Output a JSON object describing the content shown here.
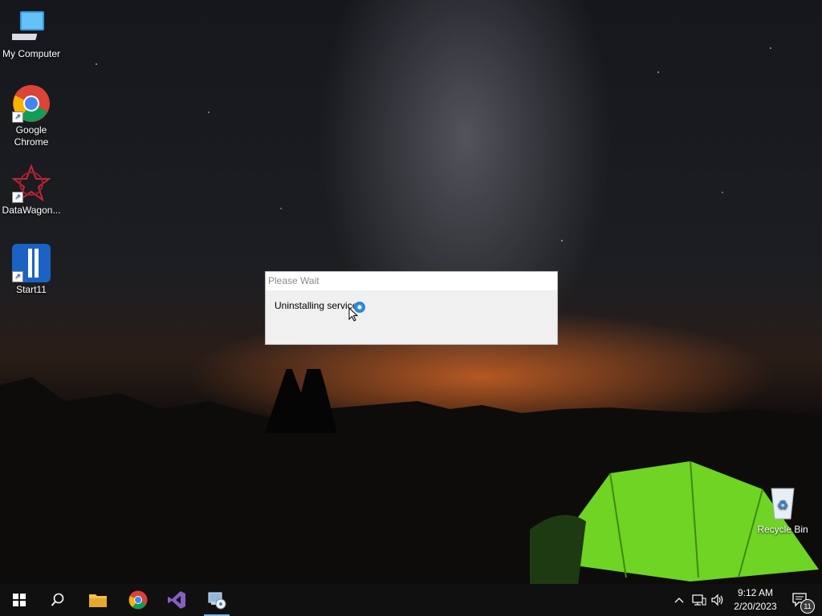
{
  "desktop": {
    "icons": [
      {
        "label": "My Computer",
        "icon": "computer-icon"
      },
      {
        "label": "Google Chrome",
        "icon": "chrome-icon"
      },
      {
        "label": "DataWagon...",
        "icon": "datawagon-icon"
      },
      {
        "label": "Start11",
        "icon": "start11-icon"
      },
      {
        "label": "Recycle Bin",
        "icon": "recycle-bin-icon"
      }
    ]
  },
  "dialog": {
    "title": "Please Wait",
    "message": "Uninstalling services"
  },
  "taskbar": {
    "buttons": [
      {
        "name": "start-button",
        "icon": "windows-logo-icon"
      },
      {
        "name": "search-button",
        "icon": "search-icon"
      },
      {
        "name": "file-explorer-button",
        "icon": "folder-icon"
      },
      {
        "name": "chrome-taskbar-button",
        "icon": "chrome-icon"
      },
      {
        "name": "visual-studio-button",
        "icon": "visual-studio-icon"
      },
      {
        "name": "installer-button",
        "icon": "installer-icon",
        "active": true
      }
    ],
    "tray": {
      "time": "9:12 AM",
      "date": "2/20/2023",
      "notification_count": "11"
    }
  },
  "colors": {
    "taskbar_bg": "#101010",
    "active_indicator": "#76b9ed",
    "dialog_bg": "#f0f0f0"
  }
}
